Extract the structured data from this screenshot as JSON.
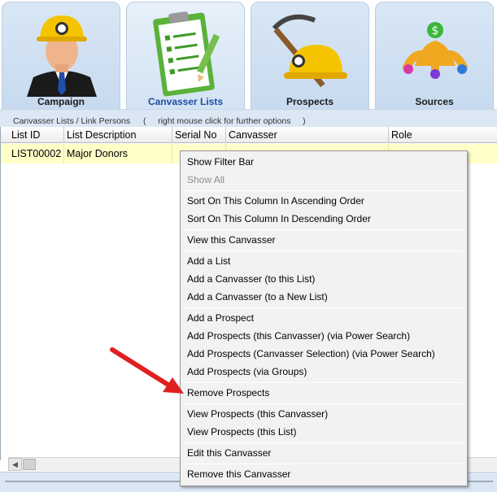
{
  "tabs": [
    {
      "label": "Campaign",
      "icon": "miner-person-icon",
      "active": false
    },
    {
      "label": "Canvasser Lists",
      "icon": "clipboard-checklist-icon",
      "active": true
    },
    {
      "label": "Prospects",
      "icon": "hardhat-pickaxe-icon",
      "active": false
    },
    {
      "label": "Sources",
      "icon": "money-fingers-icon",
      "active": false
    }
  ],
  "subbar": {
    "title": "Canvasser Lists / Link Persons",
    "hint": "(     right mouse click for further options     )"
  },
  "grid": {
    "columns": [
      "List ID",
      "List Description",
      "Serial No",
      "Canvasser",
      "Role"
    ],
    "rows": [
      {
        "list_id": "LIST00002",
        "list_description": "Major Donors",
        "serial_no": "",
        "canvasser": "",
        "role": ""
      }
    ]
  },
  "context_menu": {
    "items": [
      {
        "label": "Show Filter Bar",
        "disabled": false
      },
      {
        "label": "Show All",
        "disabled": true
      },
      {
        "label": "Sort On This Column In Ascending Order",
        "disabled": false
      },
      {
        "label": "Sort On This Column In Descending Order",
        "disabled": false
      },
      {
        "label": "View this Canvasser",
        "disabled": false
      },
      {
        "label": "Add a List",
        "disabled": false
      },
      {
        "label": "Add a Canvasser (to this List)",
        "disabled": false
      },
      {
        "label": "Add a Canvasser (to a New List)",
        "disabled": false
      },
      {
        "label": "Add a Prospect",
        "disabled": false
      },
      {
        "label": "Add Prospects (this Canvasser) (via Power Search)",
        "disabled": false
      },
      {
        "label": "Add Prospects (Canvasser Selection) (via Power Search)",
        "disabled": false
      },
      {
        "label": "Add Prospects (via Groups)",
        "disabled": false
      },
      {
        "label": "Remove Prospects",
        "disabled": false
      },
      {
        "label": "View Prospects (this Canvasser)",
        "disabled": false
      },
      {
        "label": "View Prospects (this List)",
        "disabled": false
      },
      {
        "label": "Edit this Canvasser",
        "disabled": false
      },
      {
        "label": "Remove this Canvasser",
        "disabled": false
      }
    ]
  },
  "colors": {
    "tab_background": "#c7daef",
    "active_tab_label": "#1e4fa3",
    "selected_row": "#ffffc8",
    "menu_background": "#f2f2f2",
    "annotation_arrow": "#e02020"
  }
}
